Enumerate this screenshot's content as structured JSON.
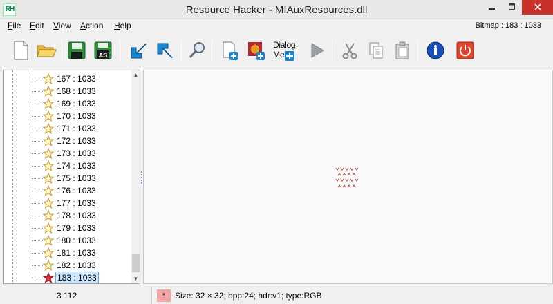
{
  "window": {
    "app_icon_text": "RH",
    "title": "Resource Hacker - MIAuxResources.dll"
  },
  "menu": {
    "items": [
      {
        "key": "F",
        "rest": "ile"
      },
      {
        "key": "E",
        "rest": "dit"
      },
      {
        "key": "V",
        "rest": "iew"
      },
      {
        "key": "A",
        "rest": "ction"
      },
      {
        "key": "H",
        "rest": "elp"
      }
    ],
    "status": "Bitmap : 183 : 1033"
  },
  "toolbar": {
    "dialog_menu_label_1": "Dialog",
    "dialog_menu_label_2": "Me",
    "save_as_label": "AS"
  },
  "tree": {
    "items": [
      {
        "label": "167 : 1033"
      },
      {
        "label": "168 : 1033"
      },
      {
        "label": "169 : 1033"
      },
      {
        "label": "170 : 1033"
      },
      {
        "label": "171 : 1033"
      },
      {
        "label": "172 : 1033"
      },
      {
        "label": "173 : 1033"
      },
      {
        "label": "174 : 1033"
      },
      {
        "label": "175 : 1033"
      },
      {
        "label": "176 : 1033"
      },
      {
        "label": "177 : 1033"
      },
      {
        "label": "178 : 1033"
      },
      {
        "label": "179 : 1033"
      },
      {
        "label": "180 : 1033"
      },
      {
        "label": "181 : 1033"
      },
      {
        "label": "182 : 1033"
      },
      {
        "label": "183 : 1033"
      }
    ],
    "selected_index": 16
  },
  "statusbar": {
    "count": "3 112",
    "modified_mark": "*",
    "info": "Size: 32 × 32;  bpp:24;  hdr:v1;  type:RGB"
  },
  "colors": {
    "accent_blue": "#1a86d0",
    "close_red": "#c7302b",
    "star_gold": "#e8c24a",
    "star_selected": "#d8243c",
    "bitmap_red": "#c0392b"
  }
}
